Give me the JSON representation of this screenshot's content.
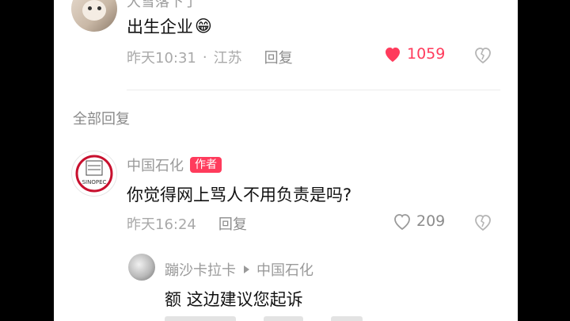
{
  "top_comment": {
    "author_partial": "大雪落下了",
    "text": "出生企业",
    "emoji": "😁",
    "time": "昨天10:31",
    "location": "江苏",
    "reply_label": "回复",
    "like_count": "1059",
    "liked": true
  },
  "section_title": "全部回复",
  "author_reply": {
    "author": "中国石化",
    "author_tag": "作者",
    "avatar_text": "SINOPEC",
    "text": "你觉得网上骂人不用负责是吗?",
    "time": "昨天16:24",
    "reply_label": "回复",
    "like_count": "209"
  },
  "nested_reply": {
    "author": "蹦沙卡拉卡",
    "reply_to": "中国石化",
    "text": "额 这边建议您起诉"
  },
  "colors": {
    "like_red": "#ff3b5c",
    "muted": "#a9a9a9",
    "text": "#111111"
  }
}
